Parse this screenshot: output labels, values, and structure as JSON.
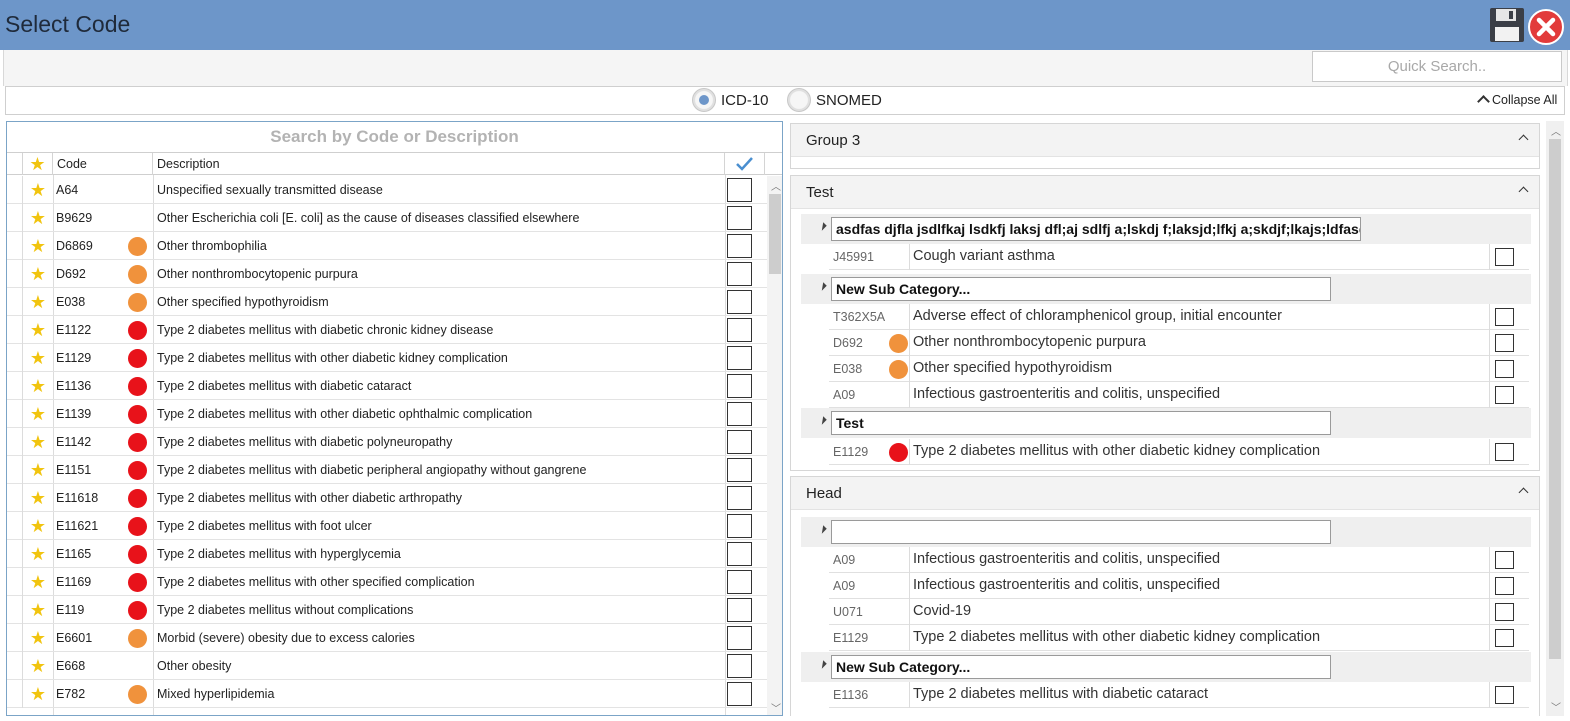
{
  "window": {
    "title": "Select Code"
  },
  "toolbar": {
    "save_icon": "save-icon",
    "close_icon": "close-icon",
    "quick_search_placeholder": "Quick Search.."
  },
  "code_system": {
    "options": [
      {
        "label": "ICD-10",
        "selected": true
      },
      {
        "label": "SNOMED",
        "selected": false
      }
    ],
    "collapse_all": "Collapse All"
  },
  "left": {
    "search_placeholder": "Search by Code or Description",
    "headers": {
      "code": "Code",
      "description": "Description"
    },
    "rows": [
      {
        "code": "A64",
        "dot": "",
        "description": "Unspecified sexually transmitted disease"
      },
      {
        "code": "B9629",
        "dot": "",
        "description": "Other Escherichia coli [E. coli] as the cause of diseases classified elsewhere"
      },
      {
        "code": "D6869",
        "dot": "orange",
        "description": "Other thrombophilia"
      },
      {
        "code": "D692",
        "dot": "orange",
        "description": "Other nonthrombocytopenic purpura"
      },
      {
        "code": "E038",
        "dot": "orange",
        "description": "Other specified hypothyroidism"
      },
      {
        "code": "E1122",
        "dot": "red",
        "description": "Type 2 diabetes mellitus with diabetic chronic kidney disease"
      },
      {
        "code": "E1129",
        "dot": "red",
        "description": "Type 2 diabetes mellitus with other diabetic kidney complication"
      },
      {
        "code": "E1136",
        "dot": "red",
        "description": "Type 2 diabetes mellitus with diabetic cataract"
      },
      {
        "code": "E1139",
        "dot": "red",
        "description": "Type 2 diabetes mellitus with other diabetic ophthalmic complication"
      },
      {
        "code": "E1142",
        "dot": "red",
        "description": "Type 2 diabetes mellitus with diabetic polyneuropathy"
      },
      {
        "code": "E1151",
        "dot": "red",
        "description": "Type 2 diabetes mellitus with diabetic peripheral angiopathy without gangrene"
      },
      {
        "code": "E11618",
        "dot": "red",
        "description": "Type 2 diabetes mellitus with other diabetic arthropathy"
      },
      {
        "code": "E11621",
        "dot": "red",
        "description": "Type 2 diabetes mellitus with foot ulcer"
      },
      {
        "code": "E1165",
        "dot": "red",
        "description": "Type 2 diabetes mellitus with hyperglycemia"
      },
      {
        "code": "E1169",
        "dot": "red",
        "description": "Type 2 diabetes mellitus with other specified complication"
      },
      {
        "code": "E119",
        "dot": "red",
        "description": "Type 2 diabetes mellitus without complications"
      },
      {
        "code": "E6601",
        "dot": "orange",
        "description": "Morbid (severe) obesity due to excess calories"
      },
      {
        "code": "E668",
        "dot": "",
        "description": "Other obesity"
      },
      {
        "code": "E782",
        "dot": "orange",
        "description": "Mixed hyperlipidemia"
      }
    ]
  },
  "right": {
    "groups": [
      {
        "title": "Group 3"
      },
      {
        "title": "Test",
        "subcategories": [
          {
            "name": "asdfas djfla jsdlfkaj lsdkfj laksj dfl;aj sdlfj a;lskdj f;laksjd;lfkj a;skdjf;lkajs;ldfasdf",
            "items": [
              {
                "code": "J45991",
                "dot": "",
                "description": "Cough variant asthma"
              }
            ]
          },
          {
            "name": "New Sub Category...",
            "items": [
              {
                "code": "T362X5A",
                "dot": "",
                "description": "Adverse effect of chloramphenicol group, initial encounter"
              },
              {
                "code": "D692",
                "dot": "orange",
                "description": "Other nonthrombocytopenic purpura"
              },
              {
                "code": "E038",
                "dot": "orange",
                "description": "Other specified hypothyroidism"
              },
              {
                "code": "A09",
                "dot": "",
                "description": "Infectious gastroenteritis and colitis, unspecified"
              }
            ]
          },
          {
            "name": "Test",
            "items": [
              {
                "code": "E1129",
                "dot": "red",
                "description": "Type 2 diabetes mellitus with other diabetic kidney complication"
              }
            ]
          }
        ]
      },
      {
        "title": "Head",
        "subcategories": [
          {
            "name": "",
            "items": [
              {
                "code": "A09",
                "dot": "",
                "description": "Infectious gastroenteritis and colitis, unspecified"
              },
              {
                "code": "A09",
                "dot": "",
                "description": "Infectious gastroenteritis and colitis, unspecified"
              },
              {
                "code": "U071",
                "dot": "",
                "description": "Covid-19"
              },
              {
                "code": "E1129",
                "dot": "",
                "description": "Type 2 diabetes mellitus with other diabetic kidney complication"
              }
            ]
          },
          {
            "name": "New Sub Category...",
            "items": [
              {
                "code": "E1136",
                "dot": "",
                "description": "Type 2 diabetes mellitus with diabetic cataract"
              }
            ]
          }
        ]
      }
    ]
  },
  "colors": {
    "titlebar": "#6d96c9",
    "star": "#f1c40f",
    "orange": "#f0923c",
    "red": "#e8121a",
    "check": "#4a8fd0"
  }
}
